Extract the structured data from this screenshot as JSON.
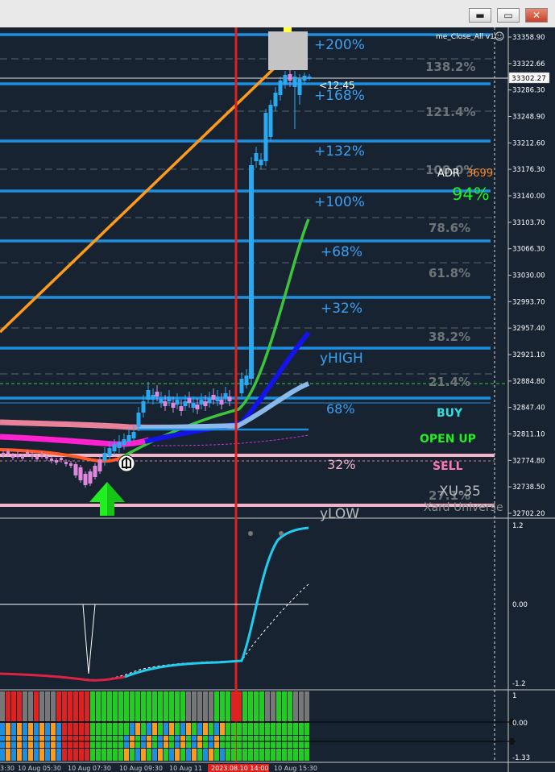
{
  "window": {
    "minimize_glyph": "▬",
    "maximize_glyph": "▭",
    "close_glyph": "✕"
  },
  "indicator_name": "me_Close_All v1",
  "current_price_label": "33302.27",
  "countdown": "<12:45",
  "levels_pct": [
    "+200%",
    "+168%",
    "+132%",
    "+100%",
    "+68%",
    "+32%",
    "68%",
    "32%"
  ],
  "fib_labels": [
    "138.2%",
    "121.4%",
    "100.0%",
    "78.6%",
    "61.8%",
    "38.2%",
    "21.4%",
    "27.1%"
  ],
  "yhigh_label": "yHIGH",
  "ylow_label": "yLOW",
  "adr": {
    "label": "ADR",
    "value": "3699",
    "pct": "94%"
  },
  "signals": {
    "buy": "BUY",
    "open_up": "OPEN UP",
    "sell": "SELL"
  },
  "symbol": "XU-35",
  "watermark": "Xard Universe",
  "price_axis": [
    "33358.90",
    "33322.66",
    "33286.30",
    "33248.90",
    "33212.60",
    "33176.30",
    "33140.00",
    "33103.70",
    "33066.30",
    "33030.00",
    "32993.70",
    "32957.40",
    "32921.10",
    "32884.80",
    "32847.40",
    "32811.10",
    "32774.80",
    "32738.50",
    "32702.20"
  ],
  "osc_axis": [
    "1.2",
    "0.00",
    "-1.2"
  ],
  "hist_axis": [
    "1",
    "0.00",
    "-1.33"
  ],
  "time_axis": [
    "3:30",
    "10 Aug 05:30",
    "10 Aug 07:30",
    "10 Aug 09:30",
    "10 Aug 11",
    "2023.08.10 14:00",
    "10 Aug 15:30"
  ],
  "colors": {
    "background": "#172331",
    "level_blue": "#1e8fe0",
    "label_blue": "#3aa0f0",
    "fib_gray": "#6e7478",
    "red_vline": "#e0201c",
    "orange_trend": "#ff9b1a",
    "green_line": "#3cc43c",
    "dark_blue_line": "#1414e8",
    "light_blue_line": "#8ab8e8",
    "magenta": "#ff20d0",
    "pink_line": "#f4b2c8",
    "candle_up": "#2aa8f0",
    "candle_down": "#dd88dd",
    "osc_cyan": "#22ccee",
    "osc_red": "#dd2244",
    "adr_orange": "#ff8820",
    "adr_green": "#22ee22",
    "buy_cyan": "#33dddd",
    "open_up_green": "#22ee22",
    "sell_pink": "#ff77bb"
  },
  "icons": [
    "minimize-icon",
    "maximize-icon",
    "close-icon",
    "smiley-icon",
    "up-arrow-icon",
    "bell-icon"
  ]
}
